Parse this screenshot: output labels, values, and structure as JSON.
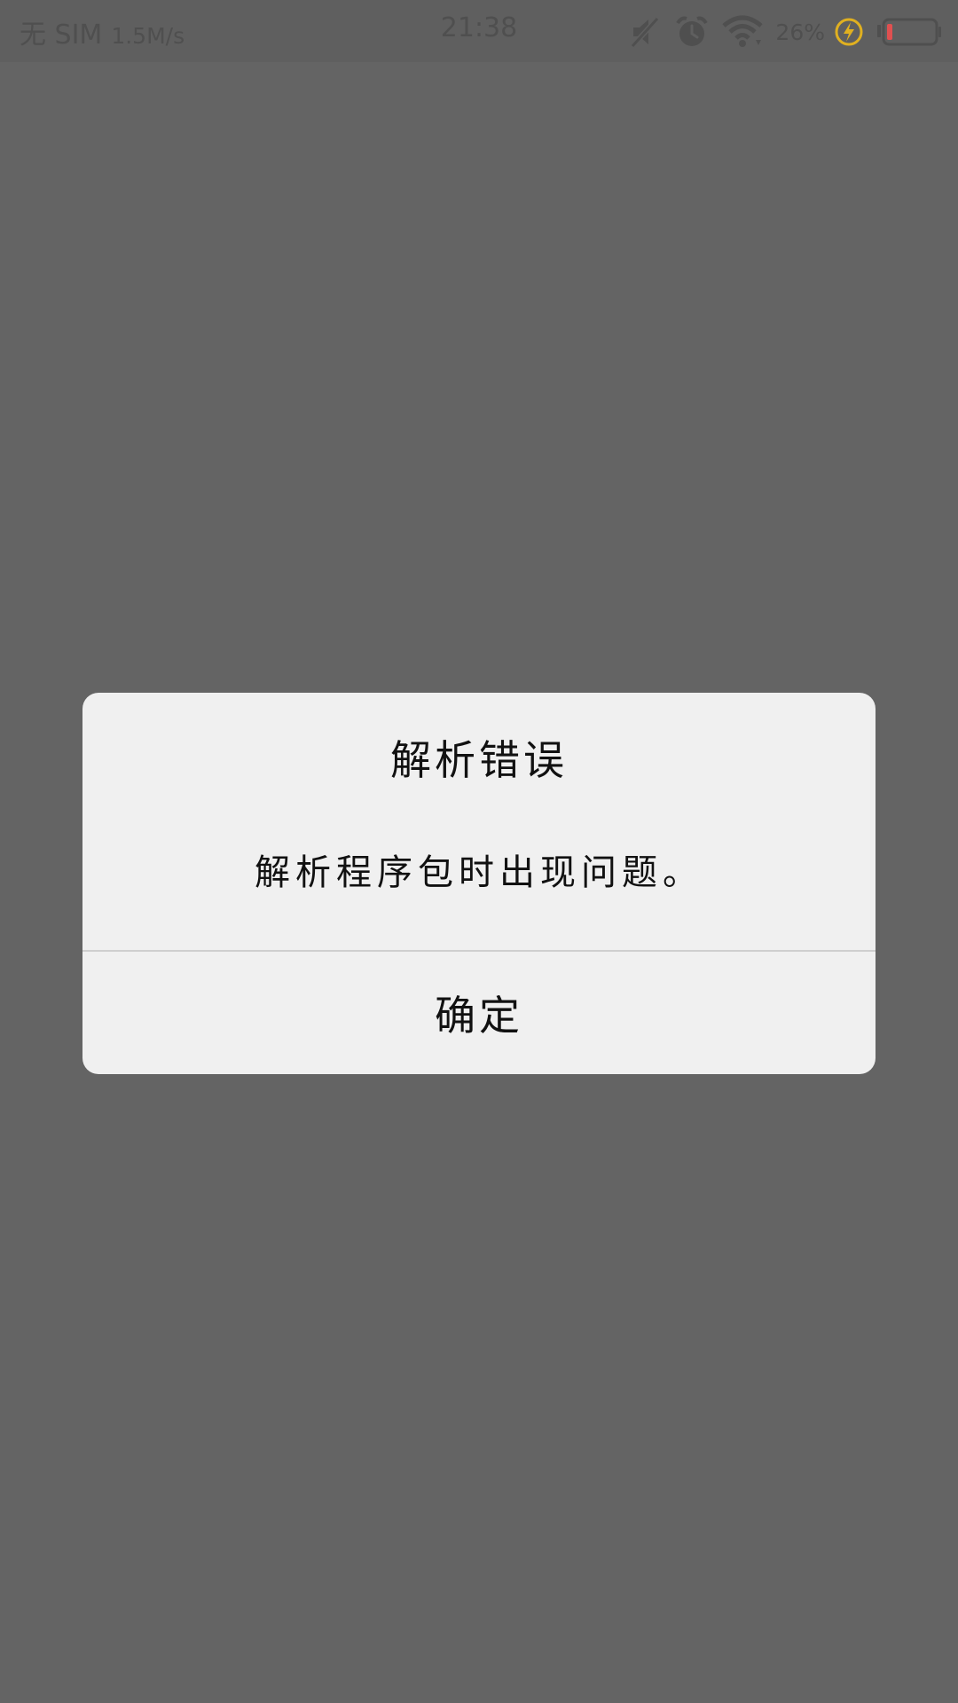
{
  "status_bar": {
    "carrier": "无 SIM",
    "speed": "1.5M/s",
    "time": "21:38",
    "battery_percent": "26%",
    "icons": [
      "mute-icon",
      "alarm-icon",
      "wifi-icon",
      "charging-icon",
      "battery-icon"
    ],
    "colors": {
      "charging": "#e0b020",
      "battery_low": "#e05050"
    }
  },
  "dialog": {
    "title": "解析错误",
    "message": "解析程序包时出现问题。",
    "ok_label": "确定"
  },
  "colors": {
    "backdrop": "#646464",
    "dialog_bg": "#f0f0f0",
    "divider": "#cfcfcf"
  }
}
